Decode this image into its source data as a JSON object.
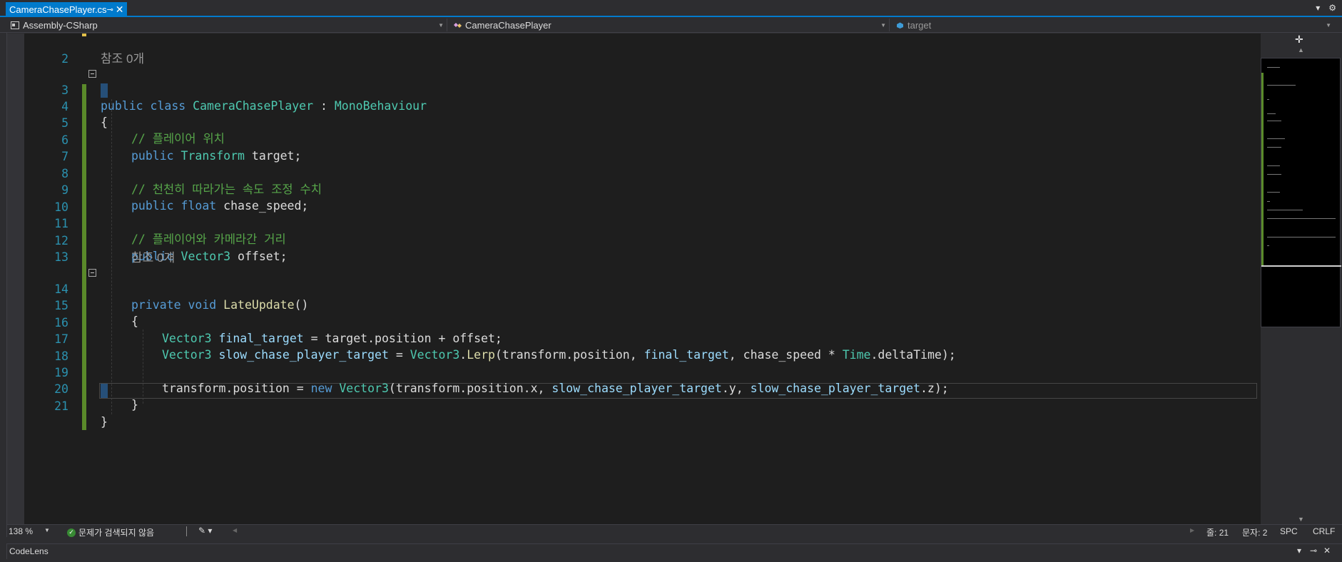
{
  "tab": {
    "title": "CameraChasePlayer.cs",
    "pin": "⊸",
    "close": "✕"
  },
  "toolbar_right": {
    "dropdown": "▾",
    "settings": "⚙"
  },
  "nav": {
    "project": "Assembly-CSharp",
    "type": "CameraChasePlayer",
    "member": "target"
  },
  "codelens_refs": [
    "참조 0개",
    "참조 0개"
  ],
  "lines": [
    {
      "num": "2"
    },
    {
      "num": "3"
    },
    {
      "num": "4"
    },
    {
      "num": "5"
    },
    {
      "num": "6"
    },
    {
      "num": "7"
    },
    {
      "num": "8"
    },
    {
      "num": "9"
    },
    {
      "num": "10"
    },
    {
      "num": "11"
    },
    {
      "num": "12"
    },
    {
      "num": "13"
    },
    {
      "num": "14"
    },
    {
      "num": "15"
    },
    {
      "num": "16"
    },
    {
      "num": "17"
    },
    {
      "num": "18"
    },
    {
      "num": "19"
    },
    {
      "num": "20"
    },
    {
      "num": "21"
    }
  ],
  "code": {
    "l3": [
      "public",
      " ",
      "class",
      " ",
      "CameraChasePlayer",
      " : ",
      "MonoBehaviour"
    ],
    "l4": "{",
    "l5": "// 플레이어 위치",
    "l6": [
      "public",
      " ",
      "Transform",
      " target;"
    ],
    "l8": "// 천천히 따라가는 속도 조정 수치",
    "l9": [
      "public",
      " ",
      "float",
      " chase_speed;"
    ],
    "l11": "// 플레이어와 카메라간 거리",
    "l12": [
      "public",
      " ",
      "Vector3",
      " offset;"
    ],
    "l14": [
      "private",
      " ",
      "void",
      " ",
      "LateUpdate",
      "()"
    ],
    "l15": "{",
    "l16": [
      "Vector3",
      " ",
      "final_target",
      " = target.position + offset;"
    ],
    "l17": [
      "Vector3",
      " ",
      "slow_chase_player_target",
      " = ",
      "Vector3",
      ".",
      "Lerp",
      "(transform.position, ",
      "final_target",
      ", chase_speed * ",
      "Time",
      ".deltaTime);"
    ],
    "l19": [
      "transform.position = ",
      "new",
      " ",
      "Vector3",
      "(transform.position.x, ",
      "slow_chase_player_target",
      ".y, ",
      "slow_chase_player_target",
      ".z);"
    ],
    "l20": "}",
    "l21": "}"
  },
  "status": {
    "zoom": "138 %",
    "issues": "문제가 검색되지 않음",
    "line": "줄: 21",
    "col": "문자: 2",
    "spc": "SPC",
    "eol": "CRLF"
  },
  "bottom_panel": {
    "title": "CodeLens",
    "dropdown": "▾",
    "pin": "⊸",
    "close": "✕"
  },
  "colors": {
    "accent": "#007acc",
    "keyword": "#569cd6",
    "type": "#4ec9b0",
    "comment": "#57a64a",
    "method": "#dcdcaa",
    "param": "#9cdcfe",
    "linenum": "#2b91af"
  }
}
